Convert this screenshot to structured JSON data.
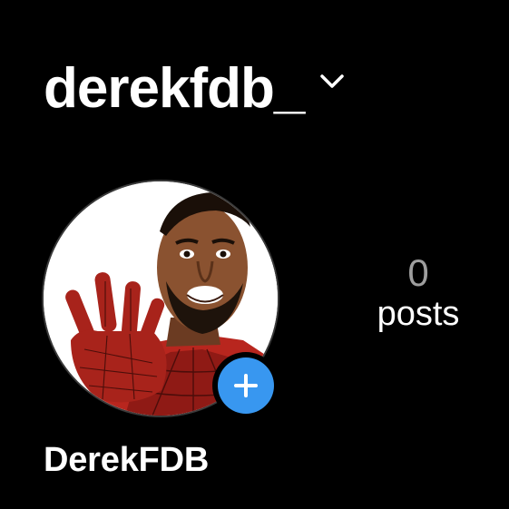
{
  "profile": {
    "username": "derekfdb_",
    "display_name": "DerekFDB",
    "username_menu_icon": "chevron-down-icon",
    "avatar_add_icon": "plus-icon"
  },
  "stats": {
    "posts_count": "0",
    "posts_label": "posts"
  },
  "colors": {
    "background": "#000000",
    "text_primary": "#ffffff",
    "text_secondary": "#9e9e9e",
    "accent_blue": "#3897f0"
  }
}
